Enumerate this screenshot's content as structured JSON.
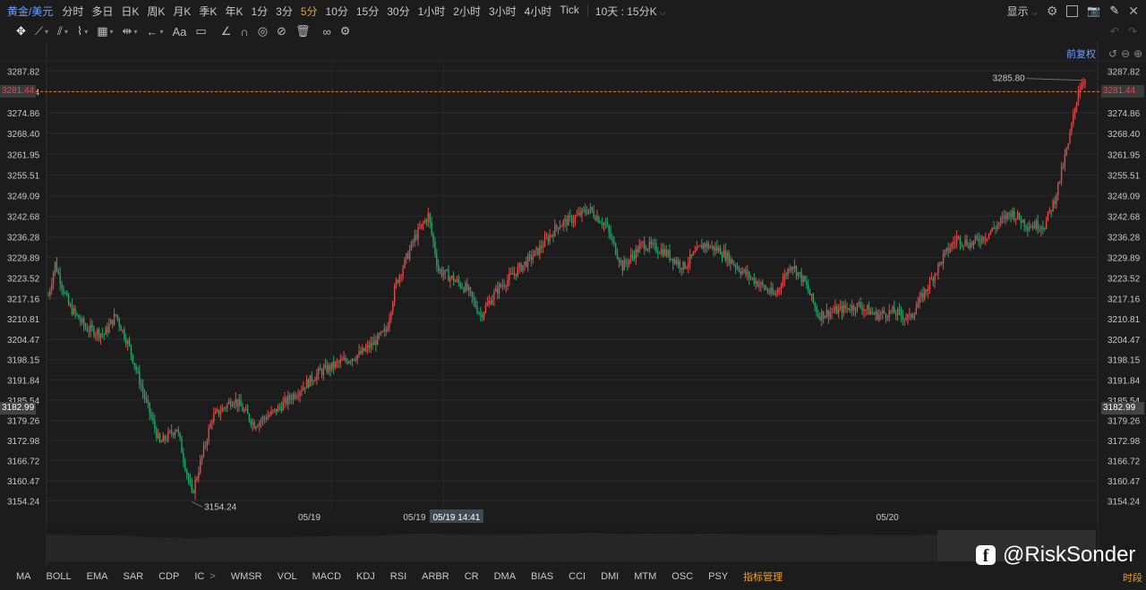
{
  "topbar": {
    "symbol": "黄金/美元",
    "timeframes": [
      "分时",
      "多日",
      "日K",
      "周K",
      "月K",
      "季K",
      "年K",
      "1分",
      "3分",
      "5分",
      "10分",
      "15分",
      "30分",
      "1小时",
      "2小时",
      "3小时",
      "4小时",
      "Tick"
    ],
    "active_timeframe": "5分",
    "range_label": "10天 : 15分K",
    "display_label": "显示"
  },
  "toolbar": {
    "adjust_label": "前复权"
  },
  "chart_data": {
    "type": "candlestick",
    "y_ticks": [
      "3287.82",
      "3281.44",
      "3274.86",
      "3268.40",
      "3261.95",
      "3255.51",
      "3249.09",
      "3242.68",
      "3236.28",
      "3229.89",
      "3223.52",
      "3217.16",
      "3210.81",
      "3204.47",
      "3198.15",
      "3191.84",
      "3185.54",
      "3179.26",
      "3172.98",
      "3166.72",
      "3160.47",
      "3154.24"
    ],
    "ylim": [
      3151,
      3291
    ],
    "x_labels": [
      {
        "label": "05/19",
        "x": 0.25
      },
      {
        "label": "05/19",
        "x": 0.35
      },
      {
        "label": "05/20",
        "x": 0.8
      }
    ],
    "crosshair_time": "05/19 14:41",
    "crosshair_time_x": 0.39,
    "current_price": "3281.44",
    "crosshair_price": "3182.99",
    "high_label": "3285.80",
    "high_label_x": 0.9,
    "low_label": "3154.24",
    "low_label_x": 0.15,
    "path": [
      [
        0,
        3218
      ],
      [
        4,
        3228
      ],
      [
        12,
        3215
      ],
      [
        22,
        3208
      ],
      [
        33,
        3206
      ],
      [
        40,
        3212
      ],
      [
        48,
        3202
      ],
      [
        56,
        3188
      ],
      [
        66,
        3172
      ],
      [
        76,
        3177
      ],
      [
        85,
        3156
      ],
      [
        97,
        3180
      ],
      [
        110,
        3186
      ],
      [
        122,
        3178
      ],
      [
        134,
        3182
      ],
      [
        147,
        3188
      ],
      [
        160,
        3194
      ],
      [
        172,
        3197
      ],
      [
        185,
        3200
      ],
      [
        192,
        3203
      ],
      [
        200,
        3207
      ],
      [
        206,
        3222
      ],
      [
        217,
        3236
      ],
      [
        225,
        3243
      ],
      [
        231,
        3226
      ],
      [
        240,
        3223
      ],
      [
        248,
        3220
      ],
      [
        256,
        3212
      ],
      [
        266,
        3220
      ],
      [
        278,
        3226
      ],
      [
        290,
        3232
      ],
      [
        302,
        3240
      ],
      [
        311,
        3242
      ],
      [
        320,
        3245
      ],
      [
        330,
        3240
      ],
      [
        340,
        3227
      ],
      [
        352,
        3234
      ],
      [
        364,
        3232
      ],
      [
        376,
        3227
      ],
      [
        388,
        3234
      ],
      [
        398,
        3232
      ],
      [
        410,
        3226
      ],
      [
        420,
        3222
      ],
      [
        430,
        3218
      ],
      [
        440,
        3228
      ],
      [
        448,
        3222
      ],
      [
        456,
        3212
      ],
      [
        464,
        3213
      ],
      [
        472,
        3214
      ],
      [
        480,
        3215
      ],
      [
        490,
        3212
      ],
      [
        500,
        3213
      ],
      [
        510,
        3211
      ],
      [
        520,
        3220
      ],
      [
        530,
        3230
      ],
      [
        538,
        3236
      ],
      [
        546,
        3234
      ],
      [
        556,
        3237
      ],
      [
        570,
        3244
      ],
      [
        580,
        3240
      ],
      [
        590,
        3240
      ],
      [
        596,
        3248
      ],
      [
        604,
        3265
      ],
      [
        610,
        3282
      ],
      [
        614,
        3286
      ]
    ],
    "y_axis_side": "both",
    "theme": "dark",
    "colors": {
      "up": "#e04b4b",
      "down": "#1fa66b",
      "grid": "#2a2a2a",
      "axis_text": "#c8c8c8",
      "price_line": "#e07a20",
      "background": "#1c1c1c"
    }
  },
  "indicators": [
    "MA",
    "BOLL",
    "EMA",
    "SAR",
    "CDP",
    "IC",
    ">",
    "WMSR",
    "VOL",
    "MACD",
    "KDJ",
    "RSI",
    "ARBR",
    "CR",
    "DMA",
    "BIAS",
    "CCI",
    "DMI",
    "MTM",
    "OSC",
    "PSY"
  ],
  "indicator_manager": "指标管理",
  "time_segment": "时段",
  "watermark": "@RiskSonder"
}
